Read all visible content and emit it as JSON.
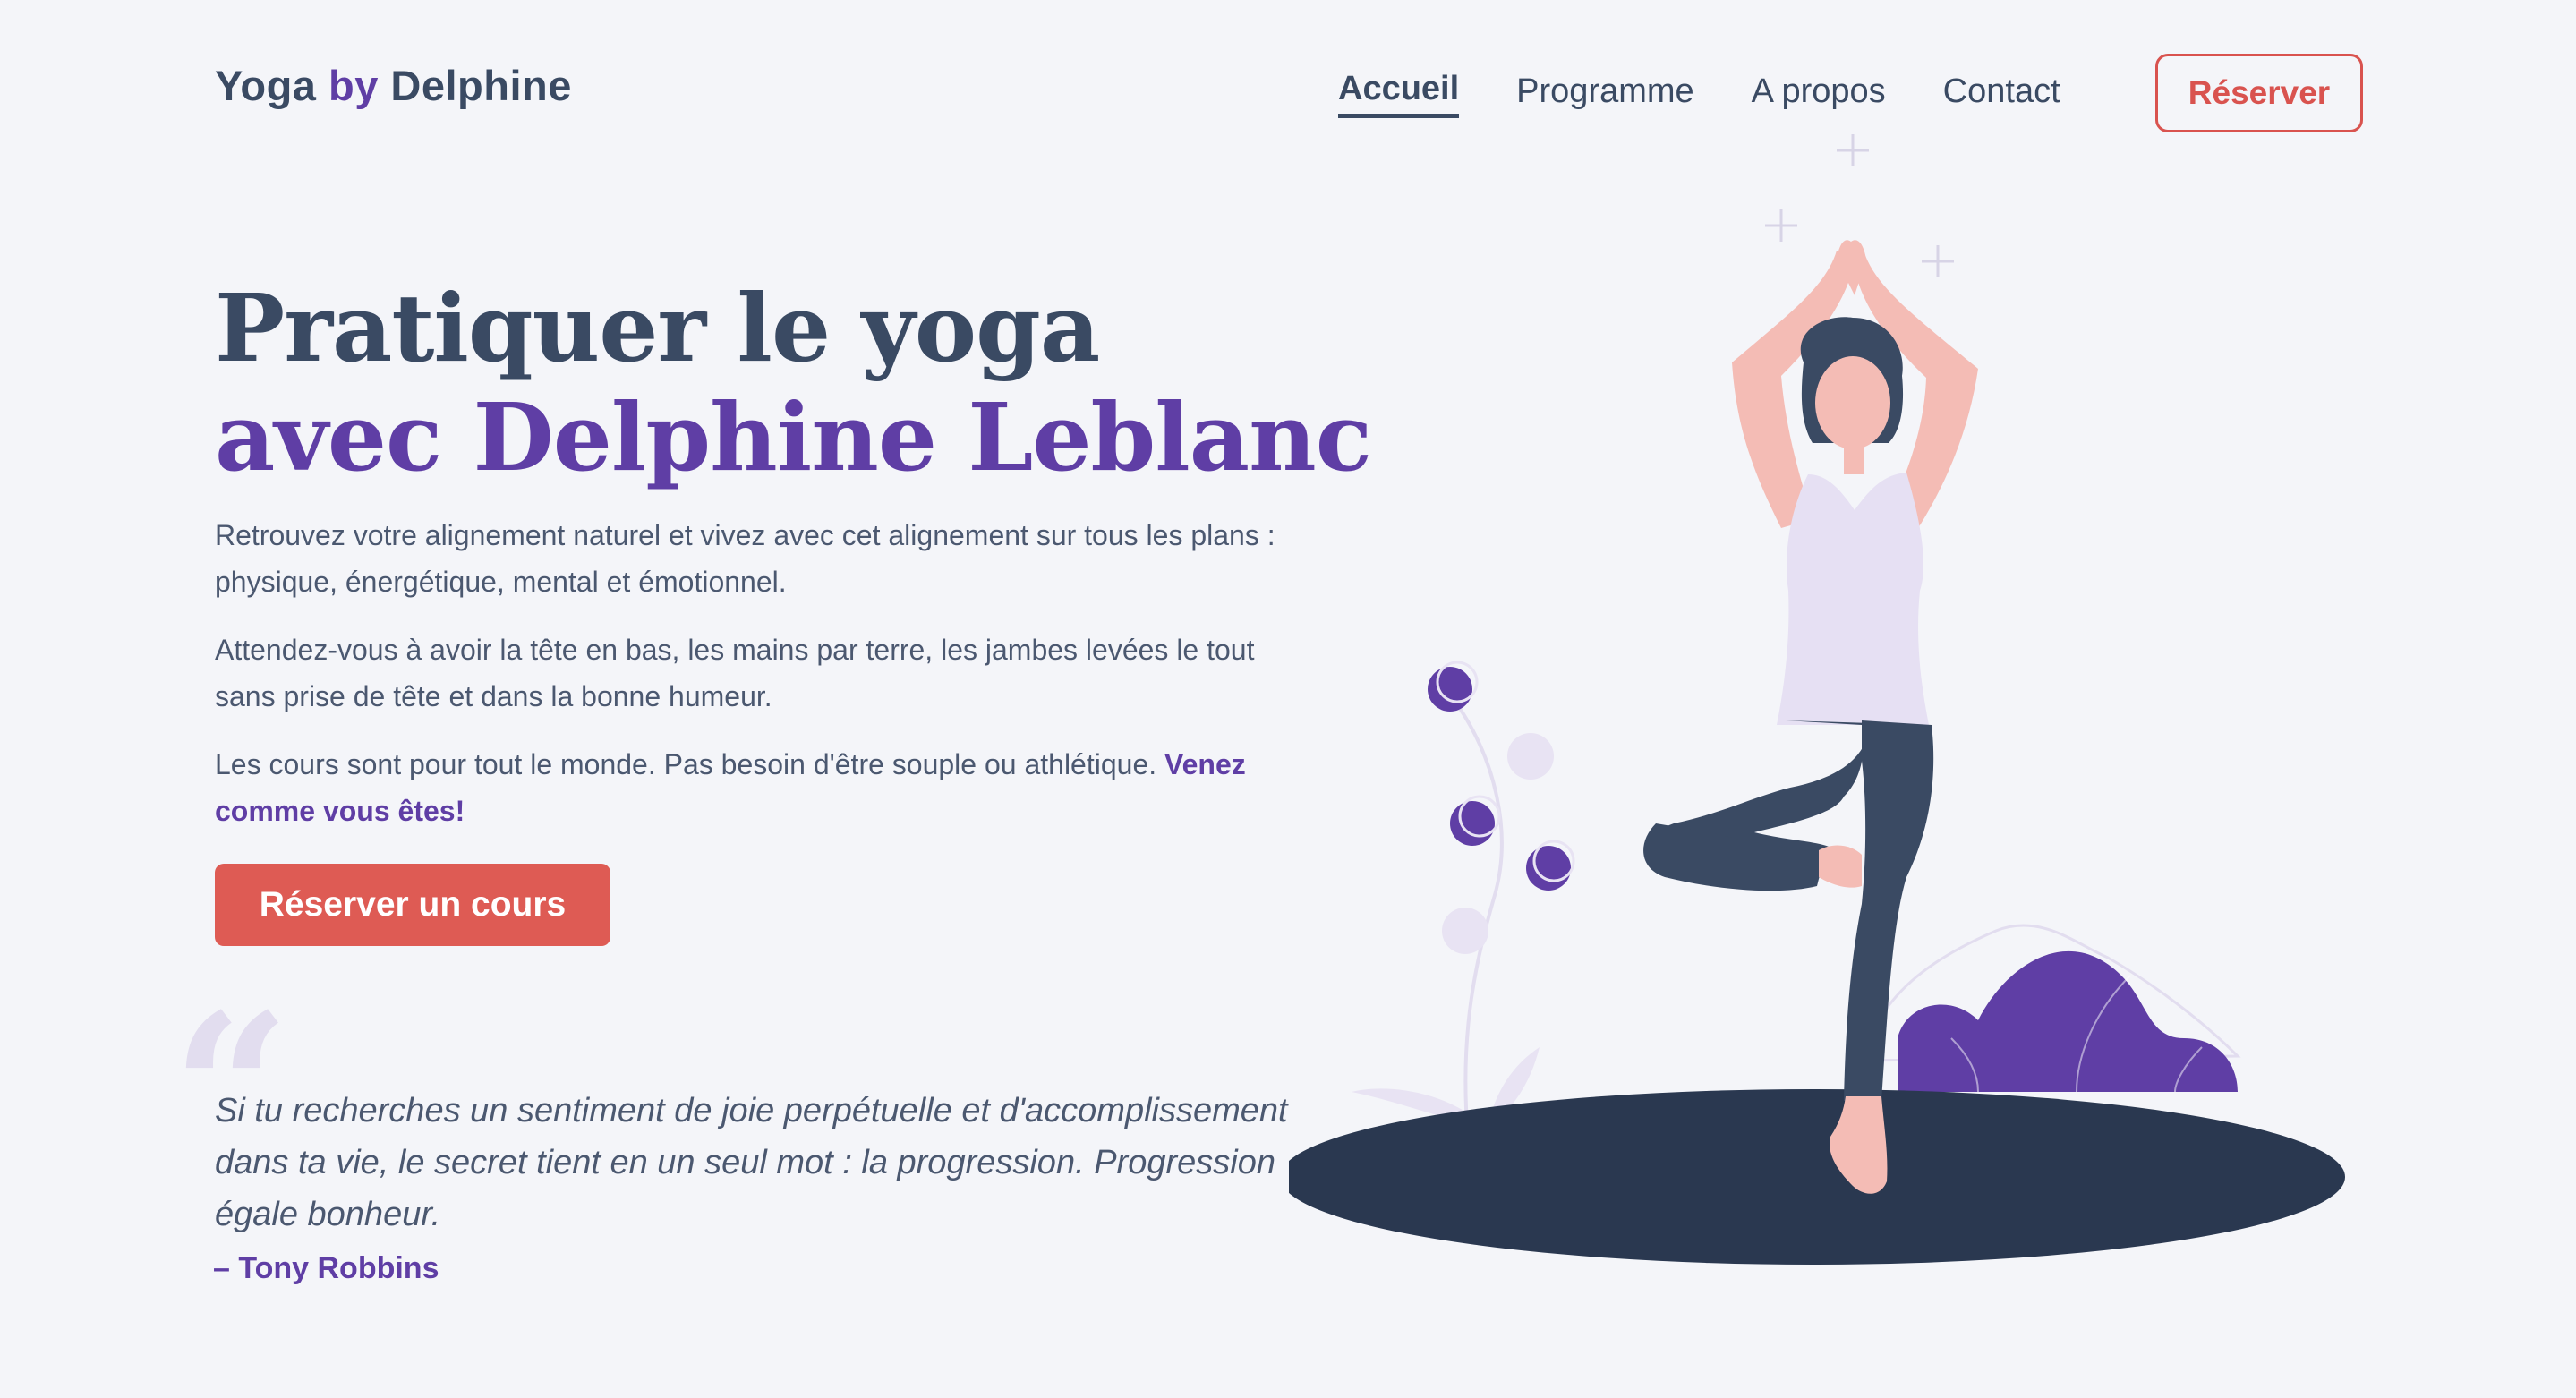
{
  "header": {
    "logo_part1": "Yoga ",
    "logo_part2": "by",
    "logo_part3": " Delphine",
    "nav": [
      {
        "label": "Accueil",
        "active": true
      },
      {
        "label": "Programme",
        "active": false
      },
      {
        "label": "A propos",
        "active": false
      },
      {
        "label": "Contact",
        "active": false
      }
    ],
    "reserve_button": "Réserver"
  },
  "hero": {
    "title_line1": "Pratiquer le yoga",
    "title_line2": "avec Delphine Leblanc",
    "para1": "Retrouvez votre alignement naturel et vivez avec cet alignement sur tous les plans : physique, énergétique, mental et émotionnel.",
    "para2": "Attendez-vous à avoir la tête en bas, les mains par terre, les jambes levées le tout sans prise de tête et dans la bonne humeur.",
    "para3": "Les cours sont pour tout le monde. Pas besoin d'être souple ou athlétique. ",
    "para3_accent": "Venez comme vous êtes!",
    "cta_button": "Réserver un cours"
  },
  "quote": {
    "mark": "“",
    "text": "Si tu recherches un sentiment de joie perpétuelle et d'accomplissement dans ta vie, le secret tient en un seul mot : la progression. Progression égale bonheur.",
    "author": "– Tony Robbins"
  },
  "colors": {
    "background": "#f4f5f9",
    "text": "#3a4a63",
    "accent_purple": "#5f3ea5",
    "accent_red": "#de5b54",
    "skin": "#f4bcb5",
    "shirt": "#e6e0f3",
    "pants": "#3a4a63",
    "mat": "#2a3850"
  },
  "illustration": {
    "icons": [
      "woman-yoga-tree-pose-illustration",
      "plant-illustration",
      "bush-illustration",
      "sparkle-icon"
    ]
  }
}
